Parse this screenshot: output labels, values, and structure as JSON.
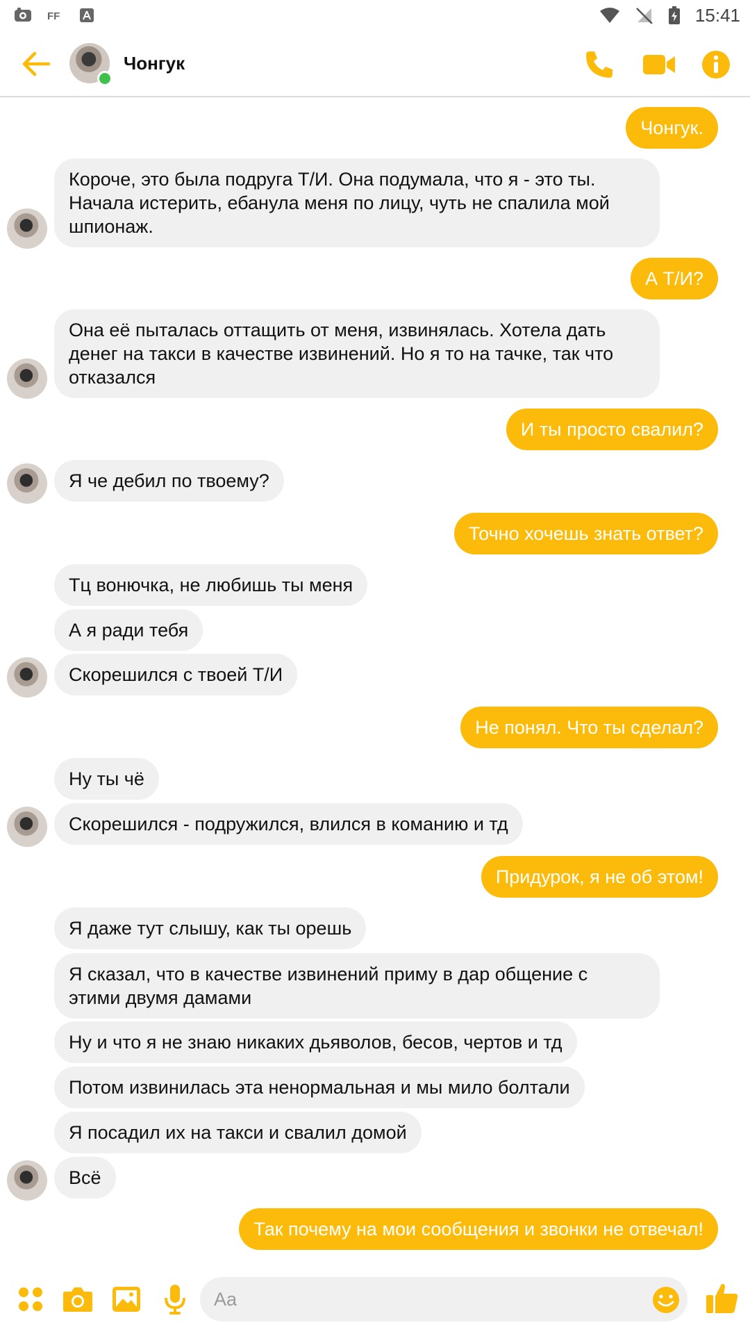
{
  "status_bar": {
    "time": "15:41",
    "left_icons": [
      "camera-notification-icon",
      "ff-icon",
      "a-icon"
    ],
    "right_icons": [
      "wifi-icon",
      "no-sim-icon",
      "battery-icon"
    ]
  },
  "header": {
    "contact_name": "Чонгук",
    "online": true,
    "accent": "#fcbb0a"
  },
  "messages": [
    {
      "from": "me",
      "text": "Чонгук."
    },
    {
      "from": "them",
      "text": "Короче, это была подруга Т/И. Она подумала, что я - это ты.\nНачала истерить, ебанула меня по лицу, чуть не спалила мой\nшпионаж."
    },
    {
      "from": "me",
      "text": "А Т/И?"
    },
    {
      "from": "them",
      "text": "Она её пыталась оттащить от меня, извинялась. Хотела дать\nденег на такси в качестве извинений. Но я то на тачке, так что\nотказался"
    },
    {
      "from": "me",
      "text": "И ты просто свалил?"
    },
    {
      "from": "them",
      "text": "Я че дебил по твоему?"
    },
    {
      "from": "me",
      "text": "Точно хочешь знать ответ?"
    },
    {
      "from": "them",
      "text": "Тц вонючка, не любишь ты меня"
    },
    {
      "from": "them",
      "text": "А я ради тебя"
    },
    {
      "from": "them",
      "text": "Скорешился с твоей Т/И"
    },
    {
      "from": "me",
      "text": "Не понял. Что ты сделал?"
    },
    {
      "from": "them",
      "text": "Ну ты чё"
    },
    {
      "from": "them",
      "text": "Скорешился - подружился, влился в команию и тд"
    },
    {
      "from": "me",
      "text": "Придурок, я не об этом!"
    },
    {
      "from": "them",
      "text": "Я даже тут слышу, как ты орешь"
    },
    {
      "from": "them",
      "text": "Я сказал, что в качестве извинений приму в дар общение с\nэтими двумя дамами"
    },
    {
      "from": "them",
      "text": "Ну и что я не знаю никаких дьяволов, бесов, чертов и тд"
    },
    {
      "from": "them",
      "text": "Потом извинилась эта ненормальная и мы мило болтали"
    },
    {
      "from": "them",
      "text": "Я посадил их на такси и свалил домой"
    },
    {
      "from": "them",
      "text": "Всё"
    },
    {
      "from": "me",
      "text": "Так почему на мои сообщения и звонки не отвечал!"
    }
  ],
  "composer": {
    "placeholder": "Aa"
  }
}
